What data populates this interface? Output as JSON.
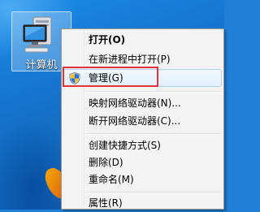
{
  "desktop": {
    "computer_icon": {
      "icon": "computer-icon",
      "label": "计算机"
    }
  },
  "context_menu": {
    "items": [
      {
        "label": "打开(O)",
        "bold": true
      },
      {
        "label": "在新进程中打开(P)"
      },
      {
        "label": "管理(G)",
        "icon": "uac-shield-icon",
        "highlighted": true
      },
      {
        "label": "映射网络驱动器(N)..."
      },
      {
        "label": "断开网络驱动器(C)..."
      },
      {
        "label": "创建快捷方式(S)"
      },
      {
        "label": "删除(D)"
      },
      {
        "label": "重命名(M)"
      },
      {
        "label": "属性(R)"
      }
    ]
  },
  "annotation": {
    "color": "#e0343c"
  }
}
